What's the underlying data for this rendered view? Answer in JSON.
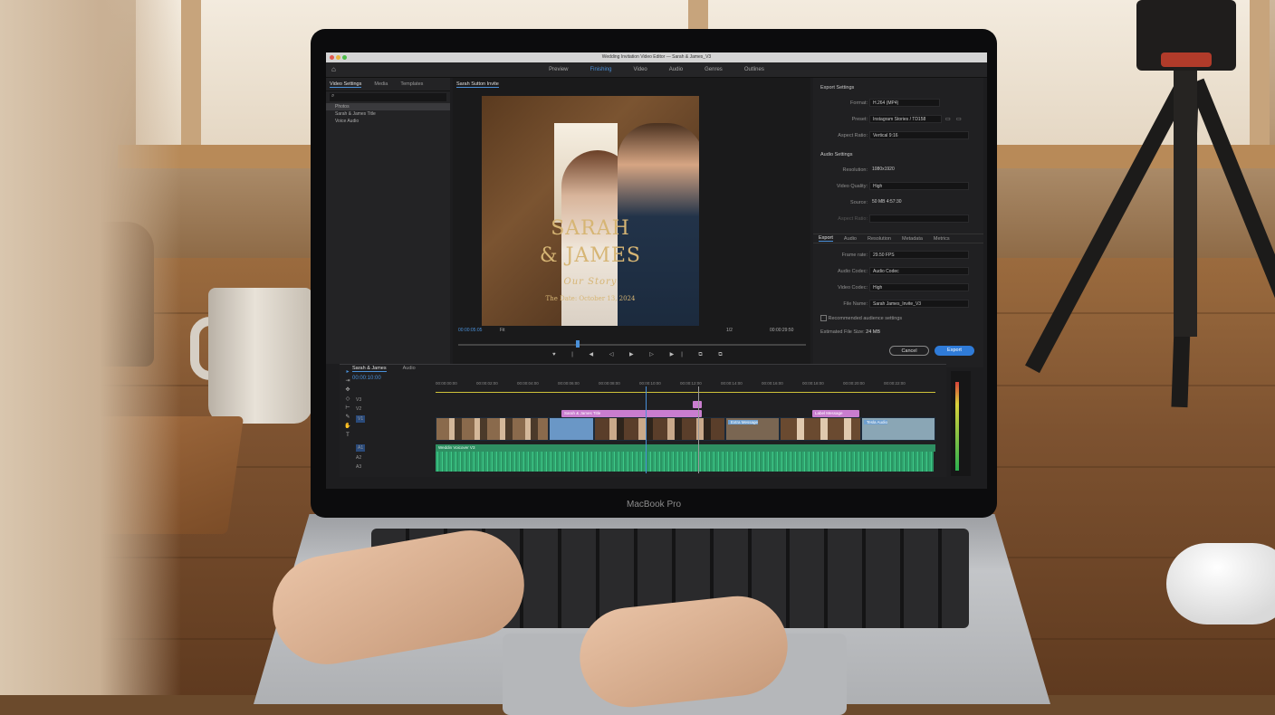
{
  "device": {
    "brand": "MacBook Pro"
  },
  "app": {
    "window_title": "Wedding Invitation Video Editor — Sarah & James_V3",
    "nav": [
      "Preview",
      "Finishing",
      "Video",
      "Audio",
      "Genres",
      "Outlines"
    ],
    "nav_active": "Finishing"
  },
  "project_panel": {
    "tabs": [
      "Video Settings",
      "Media",
      "Templates"
    ],
    "items": [
      "Photos",
      "Sarah & James Title",
      "Voice Audio"
    ]
  },
  "viewer": {
    "tab": "Sarah Sutton Invite",
    "overlay": {
      "line1": "SARAH",
      "line2": "& JAMES",
      "script": "Our Story",
      "date": "The Date: October 13, 2024"
    },
    "timecode_left": "00:00:05:05",
    "zoom": "Fit",
    "page": "1/2",
    "timecode_right": "00:00:29:50"
  },
  "export": {
    "export_settings_head": "Export Settings",
    "format_label": "Format:",
    "format_value": "H.264 (MP4)",
    "preset_label": "Preset:",
    "preset_value": "Instagram Stories / TD158",
    "aspect_label": "Aspect Ratio:",
    "aspect_value": "Vertical 9:16",
    "audio_settings_head": "Audio Settings",
    "resolution_label": "Resolution:",
    "resolution_value": "1080x1920",
    "video_quality_label": "Video Quality:",
    "video_quality_value": "High",
    "source_label": "Source:",
    "source_value": "50 MB   4:57:30",
    "aspect2_label": "Aspect Ratio:",
    "tabs": [
      "Export",
      "Audio",
      "Resolution",
      "Metadata",
      "Metrics"
    ],
    "frame_rate_label": "Frame rate:",
    "frame_rate_value": "29.50 FPS",
    "audio_codec_label": "Audio Codec:",
    "audio_codec_value": "Audio Codec",
    "video_codec_label": "Video Codec:",
    "video_codec_value": "High",
    "file_name_label": "File Name:",
    "file_name_value": "Sarah James_Invite_V3",
    "checkbox_label": "Recommended audience settings",
    "estimate_label": "Estimated File Size:",
    "estimate_value": "24 MB",
    "cancel": "Cancel",
    "export_button": "Export"
  },
  "timeline": {
    "sequence_tab": "Sarah & James",
    "audio_tab": "Audio",
    "timecode": "00:00:10:00",
    "ruler": [
      "00:00:00:00",
      "00:00:02:00",
      "00:00:04:00",
      "00:00:06:00",
      "00:00:08:00",
      "00:00:10:00",
      "00:00:12:00",
      "00:00:14:00",
      "00:00:16:00",
      "00:00:18:00",
      "00:00:20:00",
      "00:00:22:00",
      "00:00:24:00"
    ],
    "title_clips": [
      "Sarah & James Title",
      "Label Message"
    ],
    "video_clips": [
      "Extra Message",
      "Tesla Audio"
    ],
    "audio_clip": "Weddin Voicover V3",
    "track_labels": [
      "V3",
      "V2",
      "V1",
      "A1",
      "A2",
      "A3"
    ]
  },
  "colors": {
    "accent": "#4a90d9",
    "export_button": "#2f7bd8",
    "title_gold": "#d6b574",
    "audio_wave": "#3fc988",
    "title_clip": "#c97dcf"
  }
}
